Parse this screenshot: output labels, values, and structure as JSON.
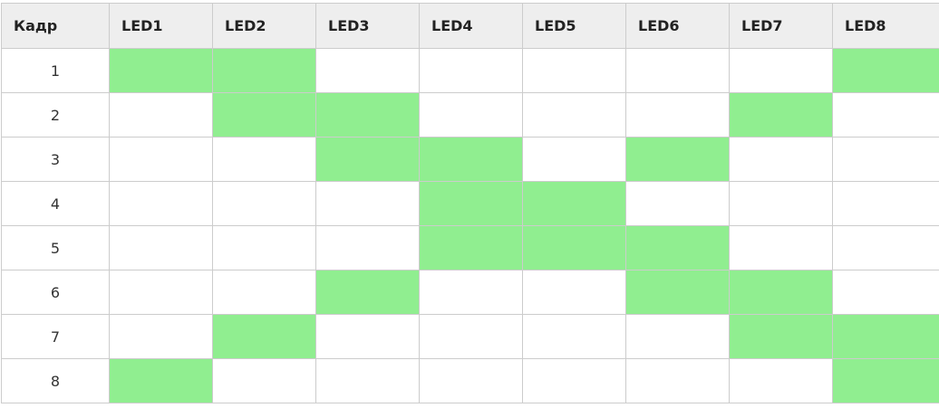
{
  "table": {
    "headers": [
      "Кадр",
      "LED1",
      "LED2",
      "LED3",
      "LED4",
      "LED5",
      "LED6",
      "LED7",
      "LED8"
    ],
    "on_color": "#90ee90",
    "rows": [
      {
        "frame": "1",
        "leds": [
          1,
          1,
          0,
          0,
          0,
          0,
          0,
          1
        ]
      },
      {
        "frame": "2",
        "leds": [
          0,
          1,
          1,
          0,
          0,
          0,
          1,
          0
        ]
      },
      {
        "frame": "3",
        "leds": [
          0,
          0,
          1,
          1,
          0,
          1,
          0,
          0
        ]
      },
      {
        "frame": "4",
        "leds": [
          0,
          0,
          0,
          1,
          1,
          0,
          0,
          0
        ]
      },
      {
        "frame": "5",
        "leds": [
          0,
          0,
          0,
          1,
          1,
          1,
          0,
          0
        ]
      },
      {
        "frame": "6",
        "leds": [
          0,
          0,
          1,
          0,
          0,
          1,
          1,
          0
        ]
      },
      {
        "frame": "7",
        "leds": [
          0,
          1,
          0,
          0,
          0,
          0,
          1,
          1
        ]
      },
      {
        "frame": "8",
        "leds": [
          1,
          0,
          0,
          0,
          0,
          0,
          0,
          1
        ]
      }
    ]
  }
}
